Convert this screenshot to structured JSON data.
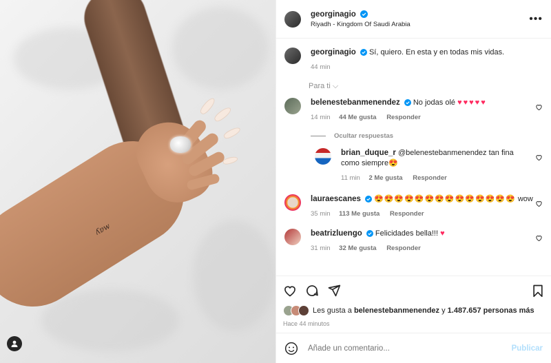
{
  "post": {
    "username": "georginagio",
    "location": "Riyadh - Kingdom Of Saudi Arabia"
  },
  "caption": {
    "username": "georginagio",
    "text": "Sí, quiero. En esta y en todas mis vidas.",
    "time": "44 min"
  },
  "filter_label": "Para ti",
  "comments": [
    {
      "username": "belenestebanmenendez",
      "text": "No jodas olé",
      "emoji": "♥♥♥♥♥",
      "time": "14 min",
      "likes": "44 Me gusta",
      "reply": "Responder"
    },
    {
      "username": "laurаescanes",
      "text": "wow",
      "emoji": "😍😍😍😍😍😍😍😍😍😍😍😍😍😍",
      "time": "35 min",
      "likes": "113 Me gusta",
      "reply": "Responder"
    },
    {
      "username": "beatrizluengo",
      "text": "Felicidades bella!!!",
      "emoji": "♥",
      "time": "31 min",
      "likes": "32 Me gusta",
      "reply": "Responder"
    }
  ],
  "hide_replies_label": "Ocultar respuestas",
  "reply": {
    "username": "brian_duque_r",
    "mention": "@belenestebanmenendez",
    "text_line1": "tan fina",
    "text_line2": "como siempre",
    "emoji": "😍",
    "time": "11 min",
    "likes": "2 Me gusta",
    "reply_label": "Responder"
  },
  "likes_summary": {
    "prefix": "Les gusta a",
    "user": "belenestebanmenendez",
    "conj": "y",
    "count": "1.487.657 personas más"
  },
  "post_time": "Hace 44 minutos",
  "add_comment": {
    "placeholder": "Añade un comentario...",
    "publish_label": "Publicar"
  },
  "tattoo_text": "ʎɐw"
}
